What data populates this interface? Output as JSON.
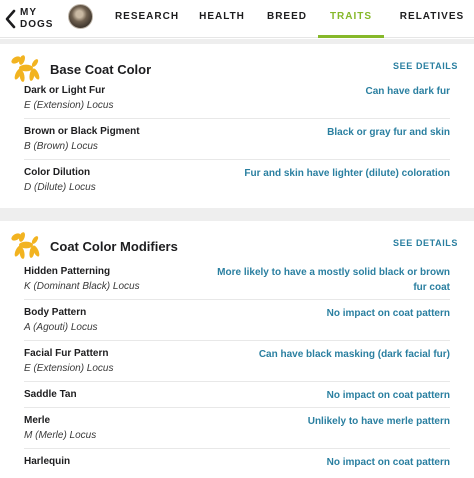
{
  "nav": {
    "back_label": "MY\nDOGS",
    "tabs": [
      {
        "label": "RESEARCH",
        "active": false
      },
      {
        "label": "HEALTH",
        "active": false
      },
      {
        "label": "BREED",
        "active": false
      },
      {
        "label": "TRAITS",
        "active": true
      },
      {
        "label": "RELATIVES",
        "active": false
      }
    ]
  },
  "colors": {
    "accent_green": "#86b82a",
    "link_blue": "#2a7fa0",
    "icon_yellow": "#f2b320"
  },
  "sections": [
    {
      "title": "Base Coat Color",
      "icon": "balloon-dog-icon",
      "see_details": "SEE DETAILS",
      "rows": [
        {
          "trait": "Dark or Light Fur",
          "locus": "E (Extension) Locus",
          "result": "Can have dark fur"
        },
        {
          "trait": "Brown or Black Pigment",
          "locus": "B (Brown) Locus",
          "result": "Black or gray fur and skin"
        },
        {
          "trait": "Color Dilution",
          "locus": "D (Dilute) Locus",
          "result": "Fur and skin have lighter (dilute) coloration"
        }
      ]
    },
    {
      "title": "Coat Color Modifiers",
      "icon": "balloon-dog-icon",
      "see_details": "SEE DETAILS",
      "rows": [
        {
          "trait": "Hidden Patterning",
          "locus": "K (Dominant Black) Locus",
          "result": "More likely to have a mostly solid black or brown fur coat"
        },
        {
          "trait": "Body Pattern",
          "locus": "A (Agouti) Locus",
          "result": "No impact on coat pattern"
        },
        {
          "trait": "Facial Fur Pattern",
          "locus": "E (Extension) Locus",
          "result": "Can have black masking (dark facial fur)"
        },
        {
          "trait": "Saddle Tan",
          "locus": "",
          "result": "No impact on coat pattern"
        },
        {
          "trait": "Merle",
          "locus": "M (Merle) Locus",
          "result": "Unlikely to have merle pattern"
        },
        {
          "trait": "Harlequin",
          "locus": "",
          "result": "No impact on coat pattern"
        }
      ]
    }
  ]
}
